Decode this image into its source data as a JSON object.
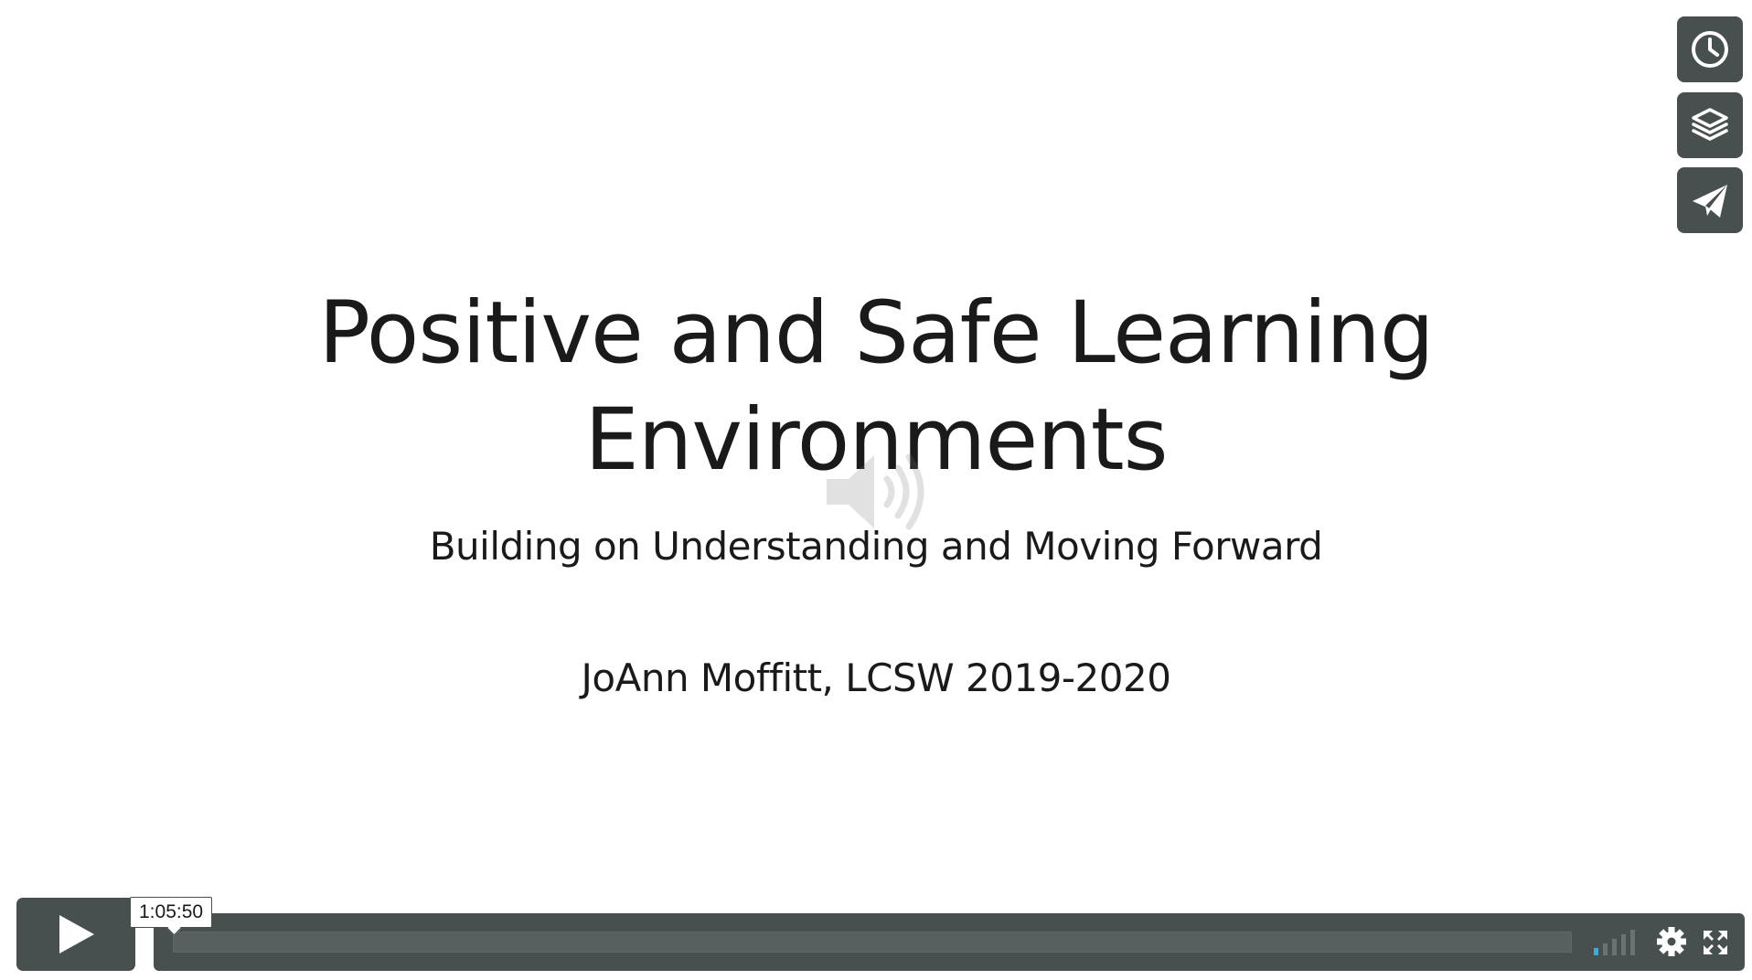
{
  "slide": {
    "title_line1": "Positive and Safe Learning",
    "title_line2": "Environments",
    "subtitle": "Building on Understanding and Moving Forward",
    "author": "JoAnn Moffitt, LCSW  2019-2020"
  },
  "controls": {
    "hover_time": "1:05:50",
    "volume_level": 0.2
  },
  "side_buttons": [
    {
      "icon": "clock-icon"
    },
    {
      "icon": "layers-icon"
    },
    {
      "icon": "paper-plane-icon"
    }
  ],
  "colors": {
    "control_bg": "#48504f",
    "volume_active": "#2fb0e8",
    "slide_text": "#1a1a1a"
  }
}
